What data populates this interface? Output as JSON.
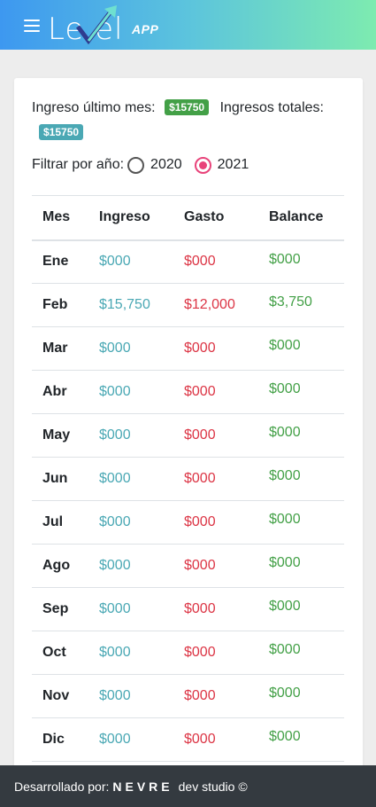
{
  "header": {
    "logo_text": "Le  el",
    "logo_app": "APP"
  },
  "summary": {
    "last_month_label": "Ingreso último mes:",
    "last_month_value": "$15750",
    "total_label": "Ingresos totales:",
    "total_value": "$15750"
  },
  "filter": {
    "label": "Filtrar por año:",
    "options": [
      "2020",
      "2021"
    ],
    "selected": "2021"
  },
  "table": {
    "headers": [
      "Mes",
      "Ingreso",
      "Gasto",
      "Balance"
    ],
    "rows": [
      [
        "Ene",
        "$000",
        "$000",
        "$000"
      ],
      [
        "Feb",
        "$15,750",
        "$12,000",
        "$3,750"
      ],
      [
        "Mar",
        "$000",
        "$000",
        "$000"
      ],
      [
        "Abr",
        "$000",
        "$000",
        "$000"
      ],
      [
        "May",
        "$000",
        "$000",
        "$000"
      ],
      [
        "Jun",
        "$000",
        "$000",
        "$000"
      ],
      [
        "Jul",
        "$000",
        "$000",
        "$000"
      ],
      [
        "Ago",
        "$000",
        "$000",
        "$000"
      ],
      [
        "Sep",
        "$000",
        "$000",
        "$000"
      ],
      [
        "Oct",
        "$000",
        "$000",
        "$000"
      ],
      [
        "Nov",
        "$000",
        "$000",
        "$000"
      ],
      [
        "Dic",
        "$000",
        "$000",
        "$000"
      ]
    ]
  },
  "footer": {
    "prefix": "Desarrollado por:",
    "brand": "NEVRE",
    "suffix": "dev studio ©"
  },
  "colors": {
    "income": "#4aa8b4",
    "expense": "#dc3545",
    "balance": "#43a047",
    "accent": "#e8437a"
  }
}
